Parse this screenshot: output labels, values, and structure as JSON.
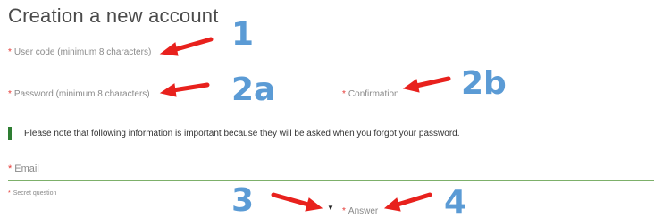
{
  "form": {
    "title": "Creation a new account",
    "user_code": {
      "required_mark": "*",
      "placeholder": "User code (minimum 8 characters)"
    },
    "password": {
      "required_mark": "*",
      "placeholder": "Password (minimum 8 characters)"
    },
    "confirmation": {
      "required_mark": "*",
      "placeholder": "Confirmation"
    },
    "notice": "Please note that following information is important because they will be asked when you forgot your password.",
    "email": {
      "required_mark": "*",
      "placeholder": "Email"
    },
    "secret_question": {
      "required_mark": "*",
      "placeholder": "Secret question",
      "dropdown_icon": "caret-down-icon"
    },
    "answer": {
      "required_mark": "*",
      "placeholder": "Answer"
    }
  },
  "annotations": {
    "labels": [
      "1",
      "2a",
      "2b",
      "3",
      "4"
    ],
    "arrow_color": "#e8211d",
    "number_color": "#5b9bd5"
  },
  "colors": {
    "required": "#e53935",
    "notice_bar": "#2e7d32",
    "active_underline": "#7db06a"
  }
}
